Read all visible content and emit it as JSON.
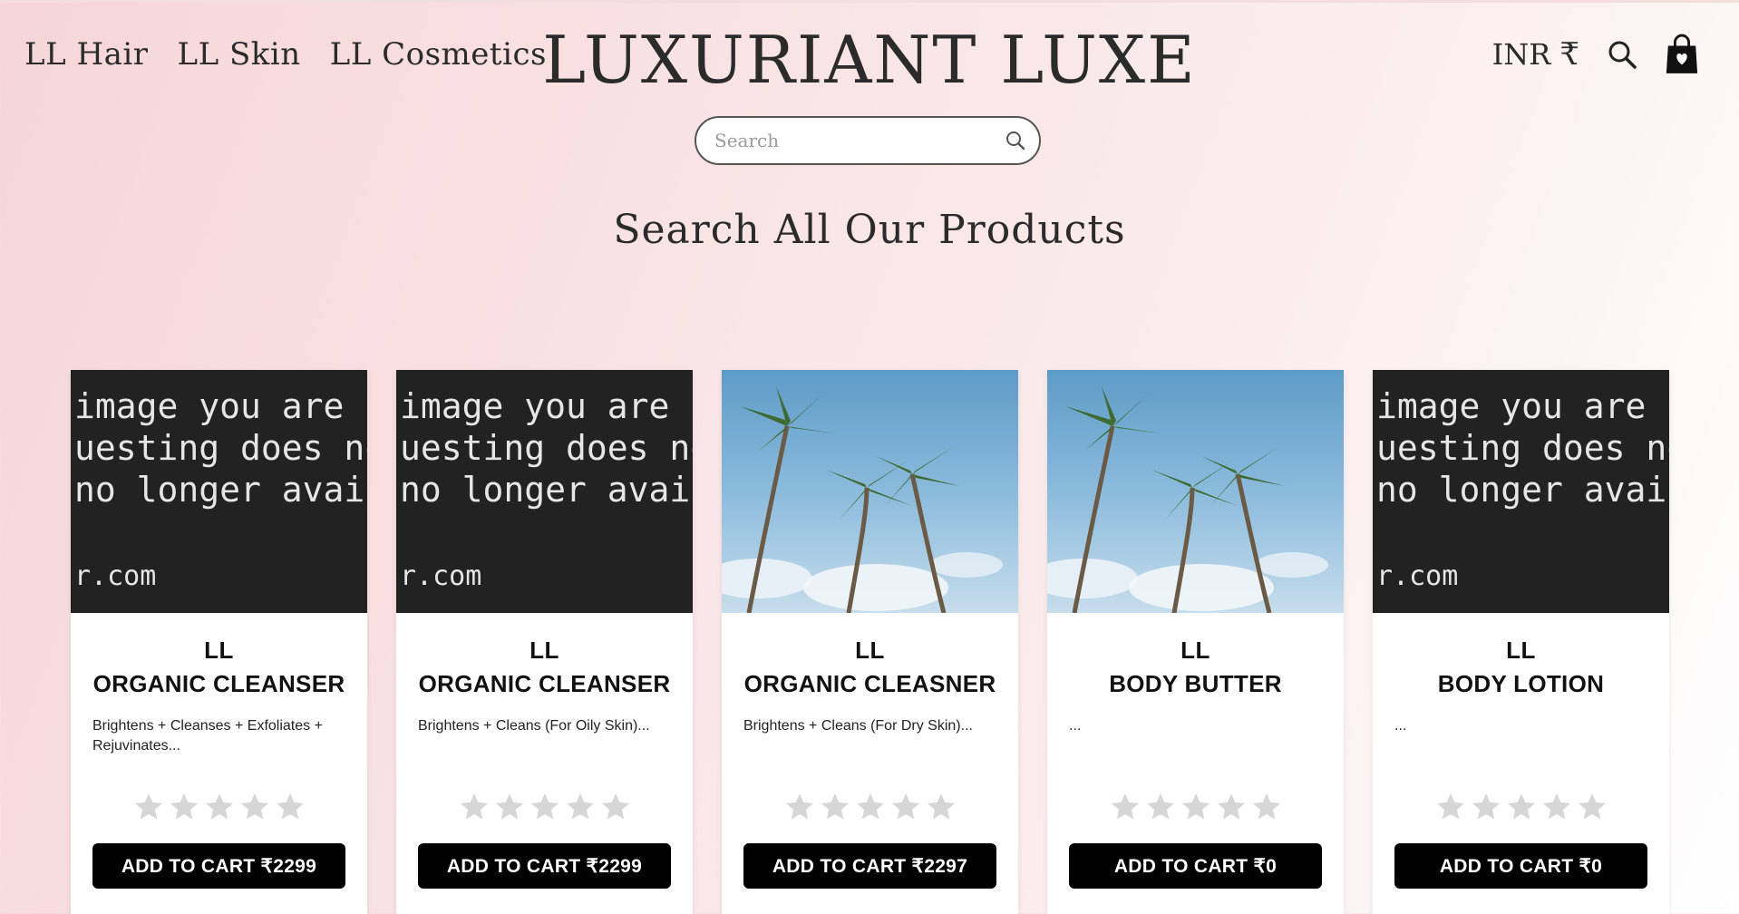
{
  "nav": {
    "left_links": [
      "LL Hair",
      "LL Skin",
      "LL Cosmetics"
    ],
    "brand": "LUXURIANT LUXE",
    "currency": "INR",
    "currency_symbol": "₹"
  },
  "search": {
    "placeholder": "Search",
    "value": ""
  },
  "page": {
    "heading": "Search All Our Products"
  },
  "products": [
    {
      "image": "unavailable-placeholder",
      "image_text": [
        "image you are",
        "uesting does not e",
        " no longer availa",
        "",
        "r.com"
      ],
      "brand": "LL",
      "name": "ORGANIC CLEANSER",
      "description": "Brightens + Cleanses + Exfoliates + Rejuvinates...",
      "rating": 0,
      "button": "ADD TO CART ₹2299"
    },
    {
      "image": "unavailable-placeholder",
      "image_text": [
        "image you are",
        "uesting does not e",
        " no longer availa",
        "",
        "r.com"
      ],
      "brand": "LL",
      "name": "ORGANIC CLEANSER",
      "description": "Brightens + Cleans (For Oily Skin)...",
      "rating": 0,
      "button": "ADD TO CART ₹2299"
    },
    {
      "image": "palm-trees-photo",
      "image_text": [],
      "brand": "LL",
      "name": "ORGANIC CLEASNER",
      "description": "Brightens + Cleans (For Dry Skin)...",
      "rating": 0,
      "button": "ADD TO CART ₹2297"
    },
    {
      "image": "palm-trees-photo",
      "image_text": [],
      "brand": "LL",
      "name": "BODY BUTTER",
      "description": "...",
      "rating": 0,
      "button": "ADD TO CART ₹0"
    },
    {
      "image": "unavailable-placeholder",
      "image_text": [
        "image you are",
        "uesting does not e",
        " no longer availa",
        "",
        "r.com"
      ],
      "brand": "LL",
      "name": "BODY LOTION",
      "description": "...",
      "rating": 0,
      "button": "ADD TO CART ₹0"
    }
  ],
  "colors": {
    "star_empty": "#d6d6d6",
    "button_bg": "#000000",
    "text": "#2b2b2b"
  }
}
